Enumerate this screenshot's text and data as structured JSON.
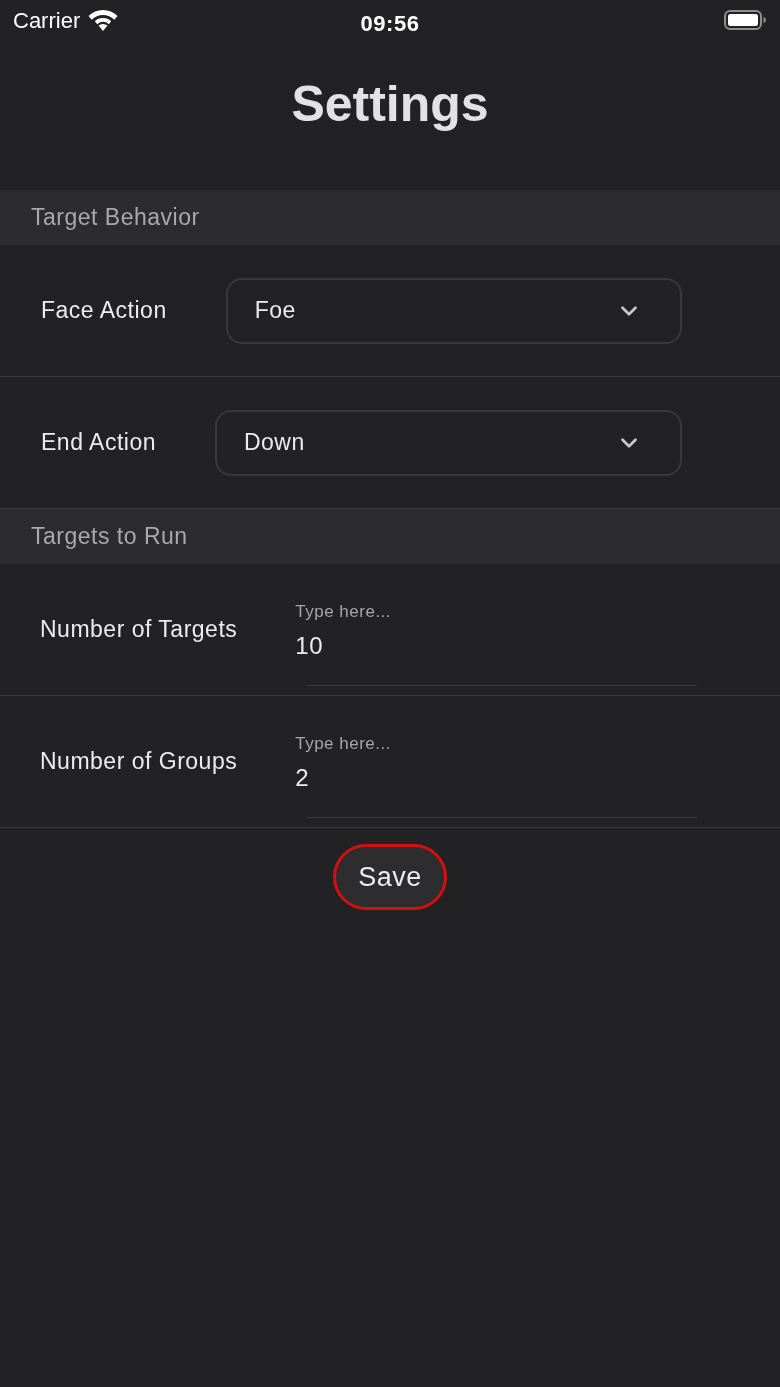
{
  "status_bar": {
    "carrier": "Carrier",
    "time": "09:56"
  },
  "title": "Settings",
  "sections": [
    {
      "header": "Target Behavior",
      "rows": [
        {
          "kind": "dropdown",
          "label": "Face Action",
          "value": "Foe"
        },
        {
          "kind": "dropdown",
          "label": "End Action",
          "value": "Down"
        }
      ]
    },
    {
      "header": "Targets to Run",
      "rows": [
        {
          "kind": "text_input",
          "label": "Number of Targets",
          "floating_label": "Type here...",
          "value": "10"
        },
        {
          "kind": "text_input",
          "label": "Number of Groups",
          "floating_label": "Type here...",
          "value": "2"
        }
      ]
    }
  ],
  "save_button": {
    "label": "Save"
  }
}
